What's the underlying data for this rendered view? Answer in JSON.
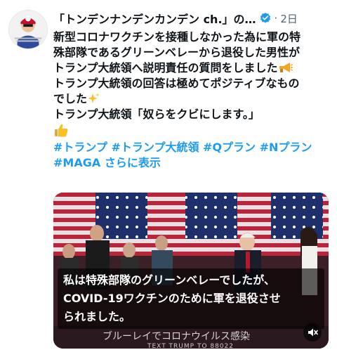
{
  "tweet": {
    "author_name": "「トンデンナンデンカンデン ch.」の…",
    "dot": "·",
    "time": "2日",
    "lines": [
      "新型コロナワクチンを接種しなかった為に軍の特",
      "殊部隊であるグリーンベレーから退役した男性が",
      "トランプ大統領へ説明責任の質問をしました",
      "トランプ大統領の回答は極めてポジティブなもの",
      "でした",
      "トランプ大統領「奴らをクビにします。」"
    ],
    "hashtags": [
      "#トランプ",
      "#トランプ大統領",
      "#Qプラン",
      "#Nプラン",
      "#MAGA"
    ],
    "show_more": "さらに表示"
  },
  "media": {
    "subtitle_lines": [
      "私は特殊部隊のグリーンベレーでしたが、",
      "COVID-19ワクチンのために軍を退役させ",
      "られました。"
    ],
    "banner_text": "ブルーレイでコロナウイルス感染",
    "text_trump": "TEXT TRUMP TO 88022"
  },
  "icons": {
    "verified": "verified-badge-icon",
    "megaphone": "megaphone-icon",
    "sparkles": "sparkles-icon",
    "thumbs_up": "thumbs-up-icon",
    "mute": "mute-icon"
  },
  "colors": {
    "link": "#1d9bf0",
    "verified": "#1d9bf0",
    "text": "#0f1419",
    "muted": "#536471"
  }
}
